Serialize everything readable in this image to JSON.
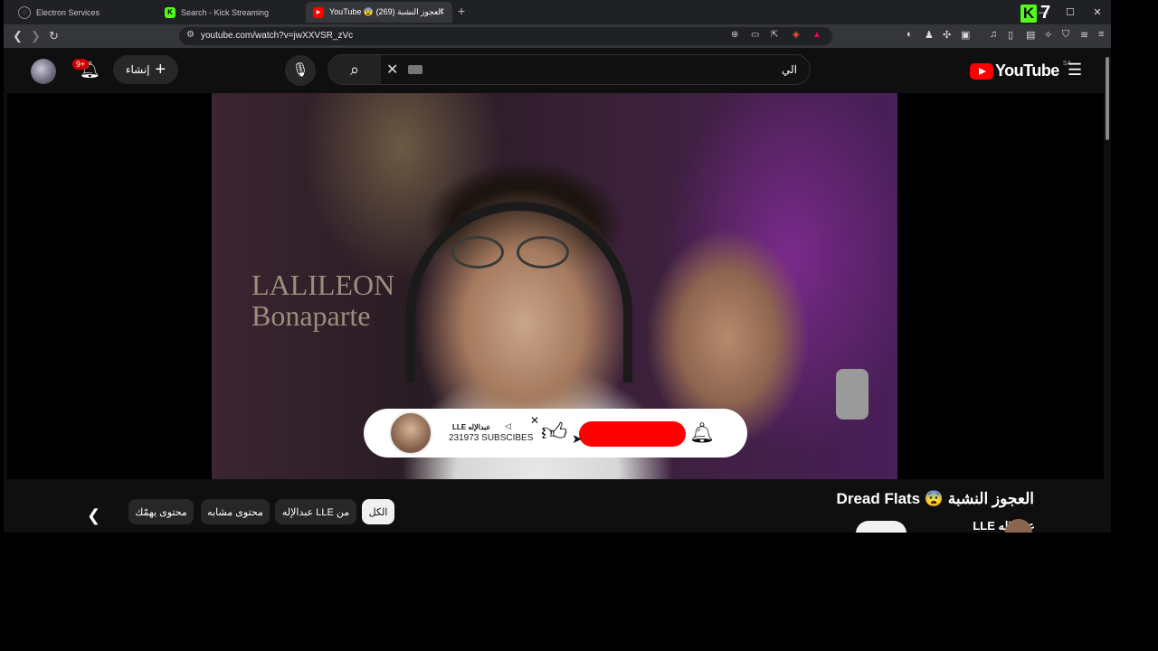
{
  "browser": {
    "tabs": [
      {
        "label": "Electron Services",
        "icon": "globe-icon"
      },
      {
        "label": "Search - Kick Streaming",
        "icon": "kick-icon"
      },
      {
        "label": "YouTube 😨 العجوز النشبة (269)",
        "icon": "youtube-icon"
      }
    ],
    "new_tab": "+",
    "window_controls": {
      "minimize": "—",
      "maximize": "☐",
      "close": "✕"
    },
    "kick_badge": "7",
    "url": "youtube.com/watch?v=jwXXVSR_zVc"
  },
  "youtube": {
    "notification_count": "9+",
    "create_label": "إنشاء",
    "search_query": "الي",
    "logo_text": "YouTube",
    "country_code": "SA",
    "overlay": {
      "channel_name": "LLE عبدالإله",
      "subscribers": "231973 SUBSCIBES"
    },
    "chips": [
      "الكل",
      "من LLE عبدالإله",
      "محتوى مشابه",
      "محتوى يهمّك"
    ],
    "active_chip": "الكل",
    "video_title": "العجوز النشبة 😨 Dread Flats",
    "channel_label": "عبدالإله LLE",
    "painting_text_line1": "LALILEON",
    "painting_text_line2": "Bonaparte"
  },
  "colors": {
    "accent": "#ff0000",
    "background": "#0f0f0f",
    "kick": "#53fc18"
  }
}
